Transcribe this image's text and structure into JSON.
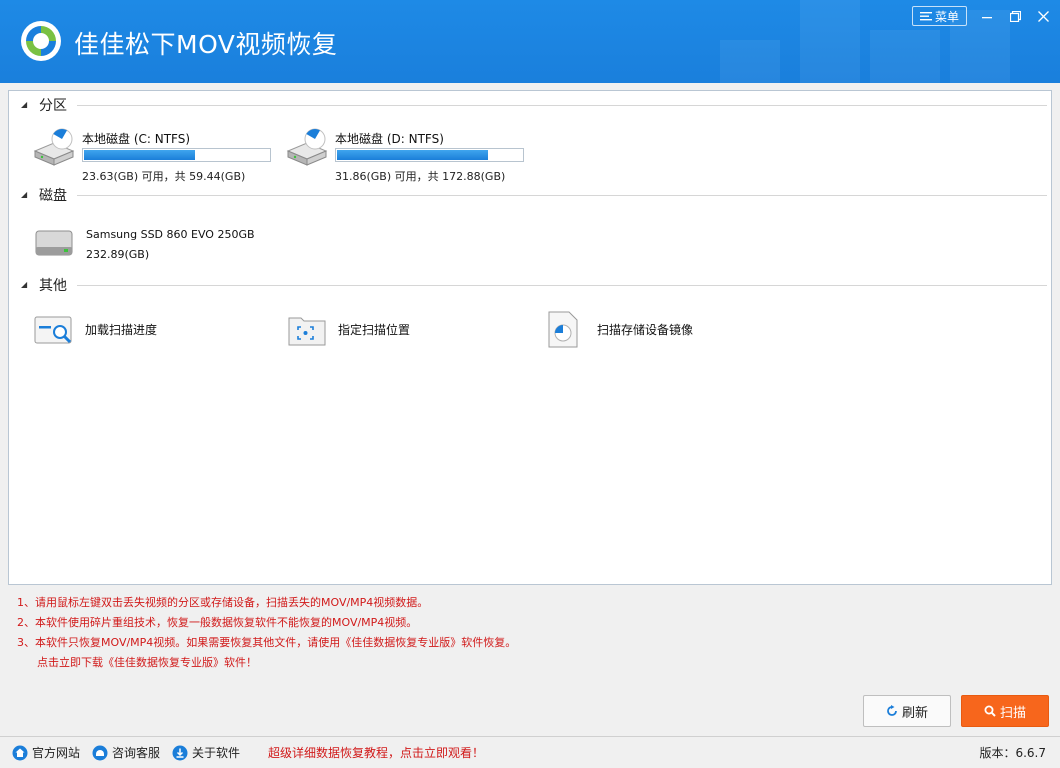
{
  "app": {
    "title": "佳佳松下MOV视频恢复",
    "menu_label": "菜单"
  },
  "sections": {
    "partition": "分区",
    "disk": "磁盘",
    "other": "其他"
  },
  "partitions": [
    {
      "name": "本地磁盘 (C: NTFS)",
      "info": "23.63(GB) 可用，共 59.44(GB)",
      "used_fraction": 0.6
    },
    {
      "name": "本地磁盘 (D: NTFS)",
      "info": "31.86(GB) 可用，共 172.88(GB)",
      "used_fraction": 0.816
    }
  ],
  "disks": [
    {
      "name": "Samsung SSD 860 EVO 250GB",
      "size": "232.89(GB)"
    }
  ],
  "other_items": [
    {
      "label": "加载扫描进度",
      "icon": "load-scan-progress-icon"
    },
    {
      "label": "指定扫描位置",
      "icon": "scan-location-icon"
    },
    {
      "label": "扫描存储设备镜像",
      "icon": "disk-image-icon"
    }
  ],
  "notes": [
    "1、请用鼠标左键双击丢失视频的分区或存储设备，扫描丢失的MOV/MP4视频数据。",
    "2、本软件使用碎片重组技术，恢复一般数据恢复软件不能恢复的MOV/MP4视频。",
    "3、本软件只恢复MOV/MP4视频。如果需要恢复其他文件，请使用《佳佳数据恢复专业版》软件恢复。",
    "点击立即下载《佳佳数据恢复专业版》软件！"
  ],
  "buttons": {
    "refresh": "刷新",
    "scan": "扫描"
  },
  "footer": {
    "website": "官方网站",
    "support": "咨询客服",
    "about": "关于软件",
    "promo": "超级详细数据恢复教程，点击立即观看！",
    "version": "版本：6.6.7"
  },
  "colors": {
    "header": "#1a7fdc",
    "accent": "#f7661c",
    "note": "#d11a1a",
    "bar": "#1b7ed9"
  }
}
